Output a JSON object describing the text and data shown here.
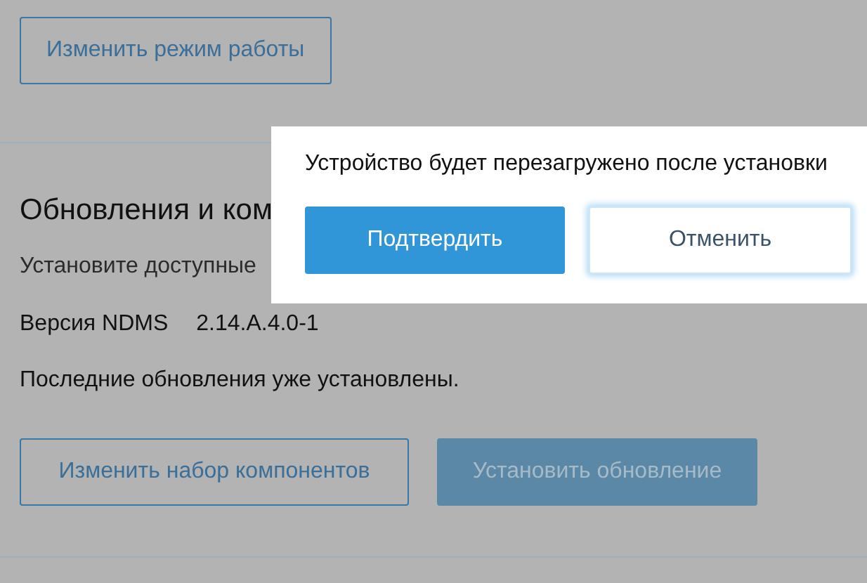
{
  "mode_button": {
    "label": "Изменить режим работы"
  },
  "updates": {
    "heading": "Обновления и ком",
    "description": "Установите доступные",
    "version_label": "Версия NDMS",
    "version_value": "2.14.A.4.0-1",
    "status": "Последние обновления уже установлены.",
    "buttons": [
      {
        "label": "Изменить набор компонентов",
        "kind": "outline",
        "disabled": false
      },
      {
        "label": "Установить обновление",
        "kind": "primary",
        "disabled": true
      }
    ]
  },
  "dialog": {
    "message": "Устройство будет перезагружено после установки",
    "buttons": [
      {
        "label": "Подтвердить",
        "kind": "primary",
        "focused": false
      },
      {
        "label": "Отменить",
        "kind": "plain",
        "focused": true
      }
    ]
  }
}
